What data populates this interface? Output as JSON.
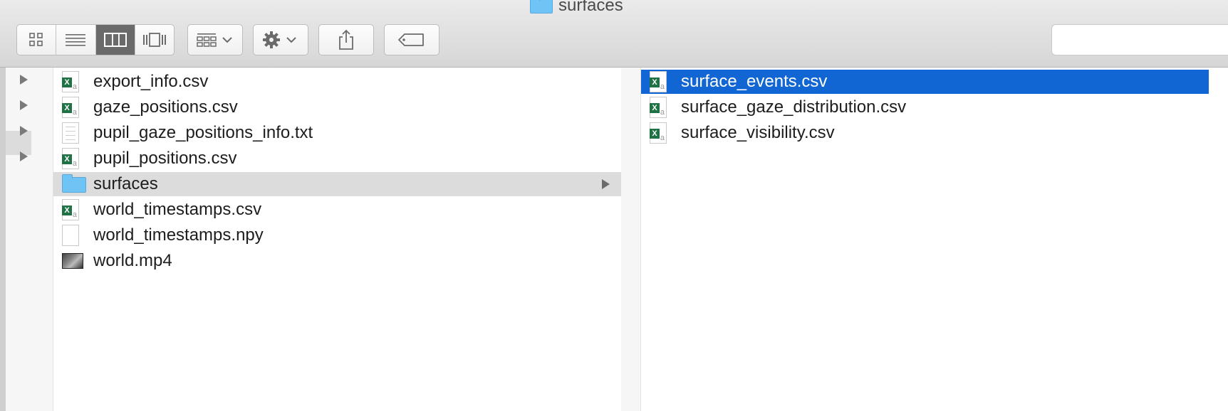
{
  "window": {
    "title": "surfaces"
  },
  "toolbar": {
    "view_modes": [
      "icon-view",
      "list-view",
      "column-view",
      "cover-flow-view"
    ],
    "active_view": "column-view"
  },
  "column1": {
    "items": [
      {
        "name": "export_info.csv",
        "type": "csv"
      },
      {
        "name": "gaze_positions.csv",
        "type": "csv"
      },
      {
        "name": "pupil_gaze_positions_info.txt",
        "type": "txt"
      },
      {
        "name": "pupil_positions.csv",
        "type": "csv"
      },
      {
        "name": "surfaces",
        "type": "folder",
        "state": "open-parent"
      },
      {
        "name": "world_timestamps.csv",
        "type": "csv"
      },
      {
        "name": "world_timestamps.npy",
        "type": "blank"
      },
      {
        "name": "world.mp4",
        "type": "movie"
      }
    ]
  },
  "column2": {
    "items": [
      {
        "name": "surface_events.csv",
        "type": "csv",
        "state": "selected"
      },
      {
        "name": "surface_gaze_distribution.csv",
        "type": "csv"
      },
      {
        "name": "surface_visibility.csv",
        "type": "csv"
      }
    ]
  },
  "colors": {
    "selection": "#1166d3",
    "folder": "#6fc3f5",
    "excel": "#1f7244"
  }
}
